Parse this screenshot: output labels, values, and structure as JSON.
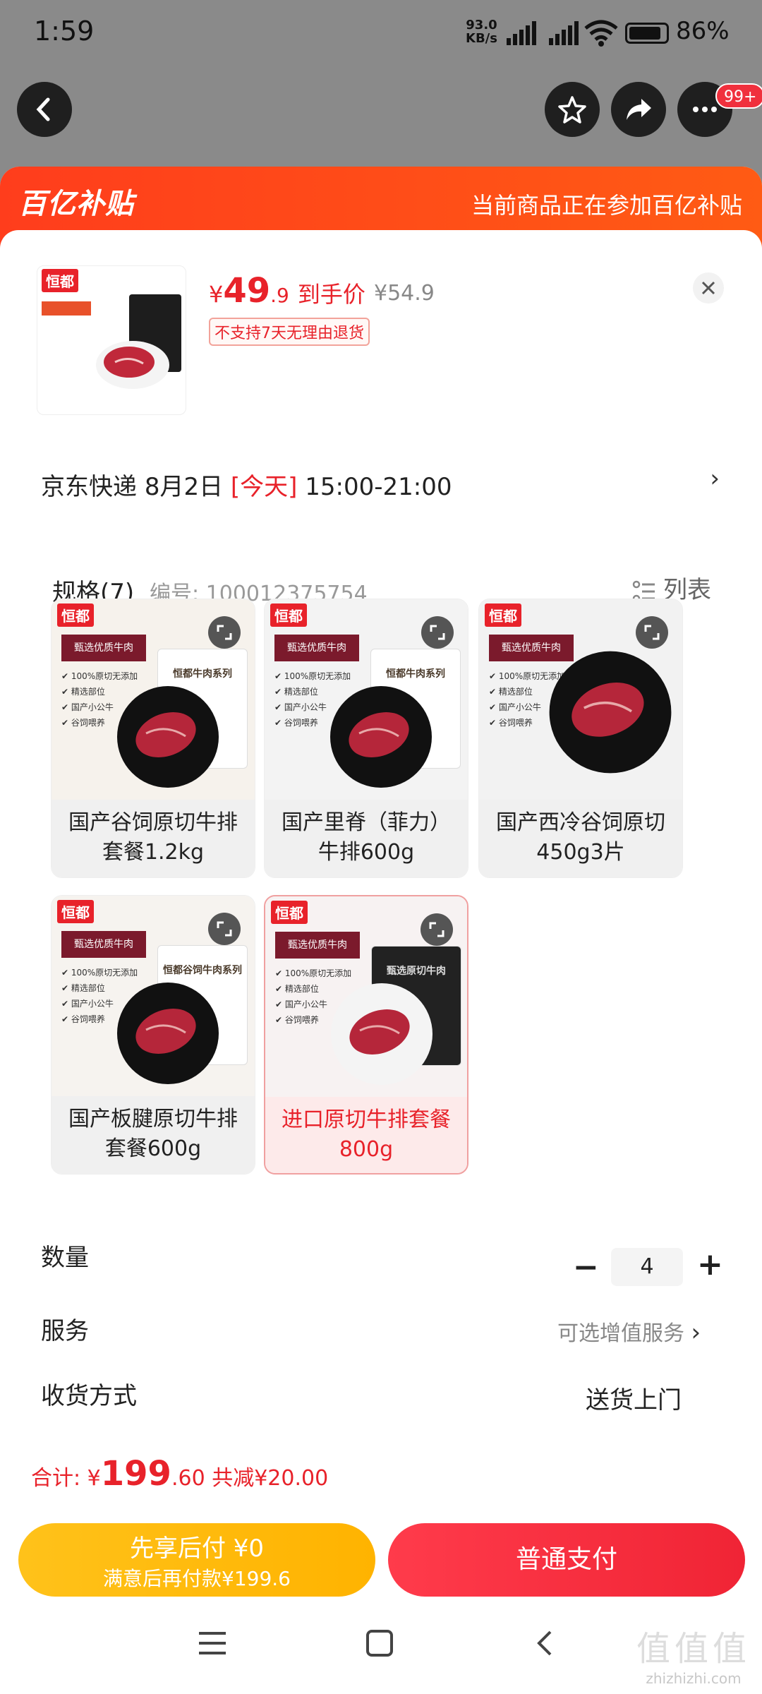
{
  "status_bar": {
    "time": "1:59",
    "net_speed_top": "93.0",
    "net_speed_bottom": "KB/s",
    "battery_pct": "86%"
  },
  "header": {
    "badge": "99+"
  },
  "banner": {
    "logo": "百亿补贴",
    "message": "当前商品正在参加百亿补贴"
  },
  "product": {
    "brand": "恒都",
    "price_yen": "¥",
    "price_int": "49",
    "price_dec": ".9",
    "price_tag": "到手价",
    "original_price": "¥54.9",
    "return_policy": "不支持7天无理由退货"
  },
  "delivery": {
    "carrier": "京东快递",
    "date": "8月2日",
    "today": "[今天]",
    "window": "15:00-21:00"
  },
  "spec": {
    "title": "规格(7)",
    "sku": "编号: 100012375754",
    "list_label": "列表",
    "options": [
      {
        "label": "国产谷饲原切牛排套餐1.2kg",
        "pack_title": "甄选优质牛肉",
        "bag_text": "恒都牛肉系列"
      },
      {
        "label": "国产里脊（菲力）牛排600g",
        "pack_title": "甄选优质牛肉",
        "bag_text": "恒都牛肉系列"
      },
      {
        "label": "国产西冷谷饲原切450g3片",
        "pack_title": "甄选优质牛肉",
        "bag_text": ""
      },
      {
        "label": "国产板腱原切牛排套餐600g",
        "pack_title": "甄选优质牛肉",
        "bag_text": "恒都谷饲牛肉系列"
      },
      {
        "label": "进口原切牛排套餐800g",
        "pack_title": "甄选优质牛肉",
        "bag_text": "甄选原切牛肉"
      }
    ],
    "selected_index": 4
  },
  "quantity": {
    "label": "数量",
    "minus": "−",
    "value": "4",
    "plus": "+"
  },
  "service": {
    "label": "服务",
    "value": "可选增值服务"
  },
  "shipping": {
    "label": "收货方式",
    "value": "送货上门"
  },
  "footer": {
    "total_label": "合计:",
    "total_yen": "¥",
    "total_int": "199",
    "total_dec": ".60",
    "discount": "共减¥20.00",
    "pay_later_line1": "先享后付 ¥0",
    "pay_later_line2": "满意后再付款¥199.6",
    "pay_now": "普通支付"
  },
  "watermark": {
    "glyphs": "值值值",
    "site": "zhizhizhi.com"
  },
  "colors": {
    "accent": "#e8222a",
    "banner": "#ff4a18",
    "pay_later": "#ffb300",
    "pay_now": "#f02435"
  }
}
